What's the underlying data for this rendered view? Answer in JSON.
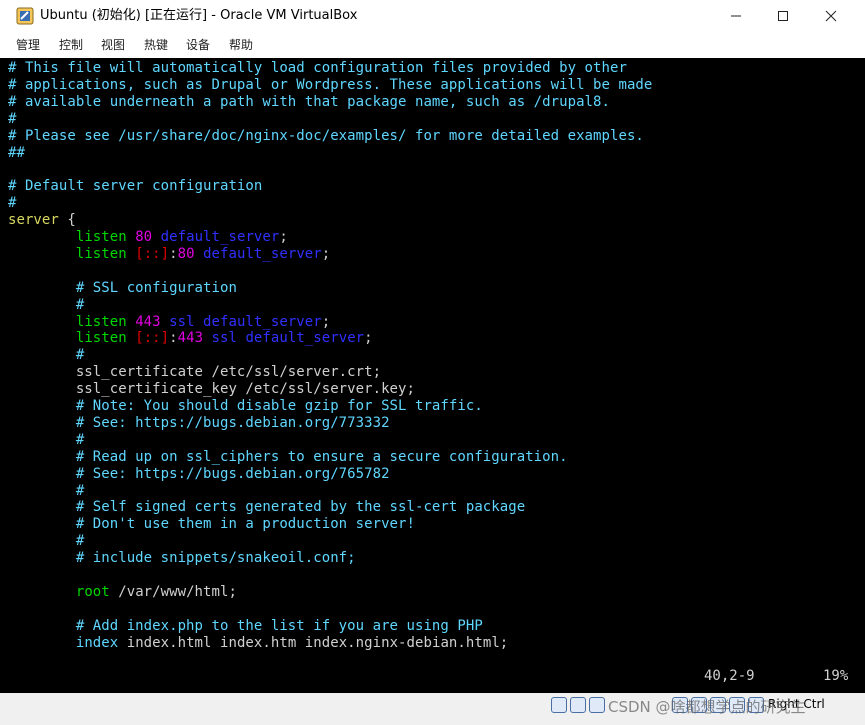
{
  "window": {
    "title": "Ubuntu (初始化) [正在运行] - Oracle VM VirtualBox",
    "buttons": {
      "minimize": "—",
      "maximize": "☐",
      "close": "✕"
    }
  },
  "menu": [
    "管理",
    "控制",
    "视图",
    "热键",
    "设备",
    "帮助"
  ],
  "terminal": {
    "lines": [
      [
        [
          "# This file will automatically load configuration files provided by other",
          "c-comment"
        ]
      ],
      [
        [
          "# applications, such as Drupal or Wordpress. These applications will be made",
          "c-comment"
        ]
      ],
      [
        [
          "# available underneath a path with that package name, such as /drupal8.",
          "c-comment"
        ]
      ],
      [
        [
          "#",
          "c-comment"
        ]
      ],
      [
        [
          "# Please see /usr/share/doc/nginx-doc/examples/ for more detailed examples.",
          "c-comment"
        ]
      ],
      [
        [
          "##",
          "c-comment"
        ]
      ],
      [],
      [
        [
          "# Default server configuration",
          "c-comment"
        ]
      ],
      [
        [
          "#",
          "c-comment"
        ]
      ],
      [
        [
          "server",
          "c-kw2"
        ],
        [
          " {",
          "c-normal"
        ]
      ],
      [
        [
          "        ",
          "c-normal"
        ],
        [
          "listen",
          "c-kw"
        ],
        [
          " ",
          "c-normal"
        ],
        [
          "80",
          "c-num"
        ],
        [
          " ",
          "c-normal"
        ],
        [
          "default_server",
          "c-arg"
        ],
        [
          ";",
          "c-normal"
        ]
      ],
      [
        [
          "        ",
          "c-normal"
        ],
        [
          "listen",
          "c-kw"
        ],
        [
          " ",
          "c-normal"
        ],
        [
          "[::]",
          "c-br"
        ],
        [
          ":",
          "c-normal"
        ],
        [
          "80",
          "c-num"
        ],
        [
          " ",
          "c-normal"
        ],
        [
          "default_server",
          "c-arg"
        ],
        [
          ";",
          "c-normal"
        ]
      ],
      [],
      [
        [
          "        # SSL configuration",
          "c-comment"
        ]
      ],
      [
        [
          "        #",
          "c-comment"
        ]
      ],
      [
        [
          "        ",
          "c-normal"
        ],
        [
          "listen",
          "c-kw"
        ],
        [
          " ",
          "c-normal"
        ],
        [
          "443",
          "c-num"
        ],
        [
          " ",
          "c-normal"
        ],
        [
          "ssl default_server",
          "c-arg"
        ],
        [
          ";",
          "c-normal"
        ]
      ],
      [
        [
          "        ",
          "c-normal"
        ],
        [
          "listen",
          "c-kw"
        ],
        [
          " ",
          "c-normal"
        ],
        [
          "[::]",
          "c-br"
        ],
        [
          ":",
          "c-normal"
        ],
        [
          "443",
          "c-num"
        ],
        [
          " ",
          "c-normal"
        ],
        [
          "ssl default_server",
          "c-arg"
        ],
        [
          ";",
          "c-normal"
        ]
      ],
      [
        [
          "        #",
          "c-comment"
        ]
      ],
      [
        [
          "        ssl_certificate /etc/ssl/server.crt;",
          "c-normal"
        ]
      ],
      [
        [
          "        ssl_certificate_key /etc/ssl/server.key;",
          "c-normal"
        ]
      ],
      [
        [
          "        # Note: You should disable gzip for SSL traffic.",
          "c-comment"
        ]
      ],
      [
        [
          "        # See: https://bugs.debian.org/773332",
          "c-comment"
        ]
      ],
      [
        [
          "        #",
          "c-comment"
        ]
      ],
      [
        [
          "        # Read up on ssl_ciphers to ensure a secure configuration.",
          "c-comment"
        ]
      ],
      [
        [
          "        # See: https://bugs.debian.org/765782",
          "c-comment"
        ]
      ],
      [
        [
          "        #",
          "c-comment"
        ]
      ],
      [
        [
          "        # Self signed certs generated by the ssl-cert package",
          "c-comment"
        ]
      ],
      [
        [
          "        # Don't use them in a production server!",
          "c-comment"
        ]
      ],
      [
        [
          "        #",
          "c-comment"
        ]
      ],
      [
        [
          "        # include snippets/snakeoil.conf;",
          "c-comment"
        ]
      ],
      [],
      [
        [
          "        ",
          "c-normal"
        ],
        [
          "root",
          "c-kw"
        ],
        [
          " /var/www/html;",
          "c-normal"
        ]
      ],
      [],
      [
        [
          "        # Add index.php to the list if you are using PHP",
          "c-comment"
        ]
      ],
      [
        [
          "        ",
          "c-normal"
        ],
        [
          "index",
          "c-comment"
        ],
        [
          " index.html index.htm index.nginx-debian.html;",
          "c-normal"
        ]
      ]
    ],
    "cursor_position": "40,2-9",
    "scroll_percent": "19%"
  },
  "statusbar": {
    "host_key": "Right Ctrl",
    "watermark": "CSDN @啥都想学点的研究生"
  },
  "colors": {
    "terminal_bg": "#000000",
    "comment": "#5fd7ff",
    "keyword": "#00d700"
  }
}
